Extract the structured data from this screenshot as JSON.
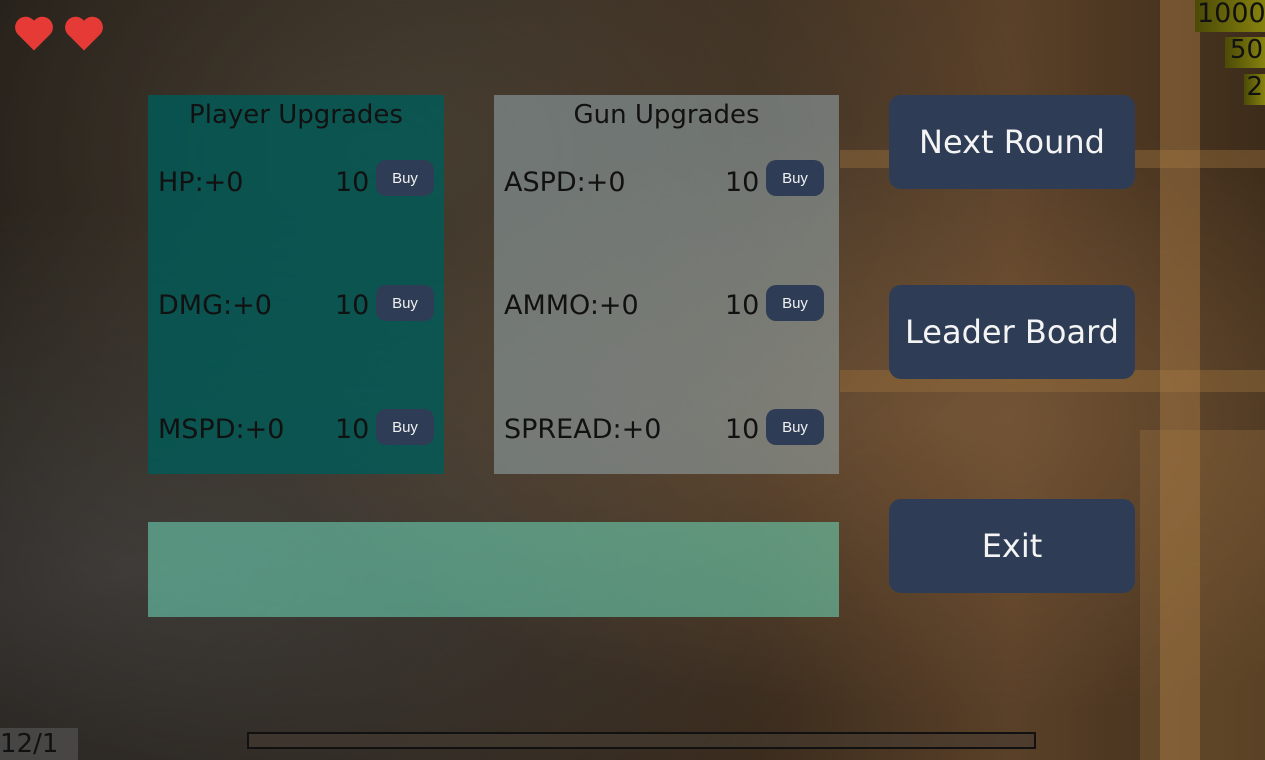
{
  "hud": {
    "hearts": 2,
    "heart_color": "#e53a35",
    "counters": [
      "1000",
      "50",
      "2"
    ],
    "round": "12/1",
    "progress": 0
  },
  "player_panel": {
    "title": "Player Upgrades",
    "rows": [
      {
        "label": "HP:+0",
        "cost": "10",
        "button": "Buy"
      },
      {
        "label": "DMG:+0",
        "cost": "10",
        "button": "Buy"
      },
      {
        "label": "MSPD:+0",
        "cost": "10",
        "button": "Buy"
      }
    ]
  },
  "gun_panel": {
    "title": "Gun Upgrades",
    "rows": [
      {
        "label": "ASPD:+0",
        "cost": "10",
        "button": "Buy"
      },
      {
        "label": "AMMO:+0",
        "cost": "10",
        "button": "Buy"
      },
      {
        "label": "SPREAD:+0",
        "cost": "10",
        "button": "Buy"
      }
    ]
  },
  "menu": {
    "next_round": "Next Round",
    "leader_board": "Leader Board",
    "exit": "Exit"
  },
  "colors": {
    "button_bg": "#2e3d55",
    "player_panel_bg": "#005a58",
    "gun_panel_bg": "#96aaaf",
    "message_bg": "#6edcbe"
  }
}
